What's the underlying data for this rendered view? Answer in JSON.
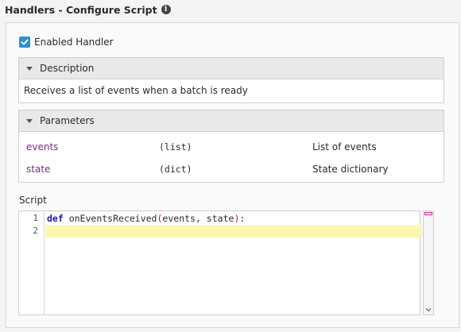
{
  "header": {
    "title": "Handlers - Configure Script",
    "info_icon": "info-icon"
  },
  "enabled_handler": {
    "label": "Enabled Handler",
    "checked": true,
    "color": "#2e8fd6"
  },
  "description": {
    "title": "Description",
    "text": "Receives a list of events when a batch is ready"
  },
  "parameters": {
    "title": "Parameters",
    "rows": [
      {
        "name": "events",
        "type": "(list)",
        "desc": "List of events"
      },
      {
        "name": "state",
        "type": "(dict)",
        "desc": "State dictionary"
      }
    ]
  },
  "script": {
    "label": "Script",
    "line_numbers": [
      "1",
      "2"
    ],
    "line1": {
      "kw": "def",
      "name": " onEventsReceived",
      "open": "(",
      "args": "events, state",
      "close": ")",
      "colon": ":"
    },
    "line2": ""
  },
  "colors": {
    "param_name": "#7b2b86",
    "keyword": "#1a1aa6",
    "paren": "#c0152b",
    "highlight_line": "#fbf7b1"
  }
}
